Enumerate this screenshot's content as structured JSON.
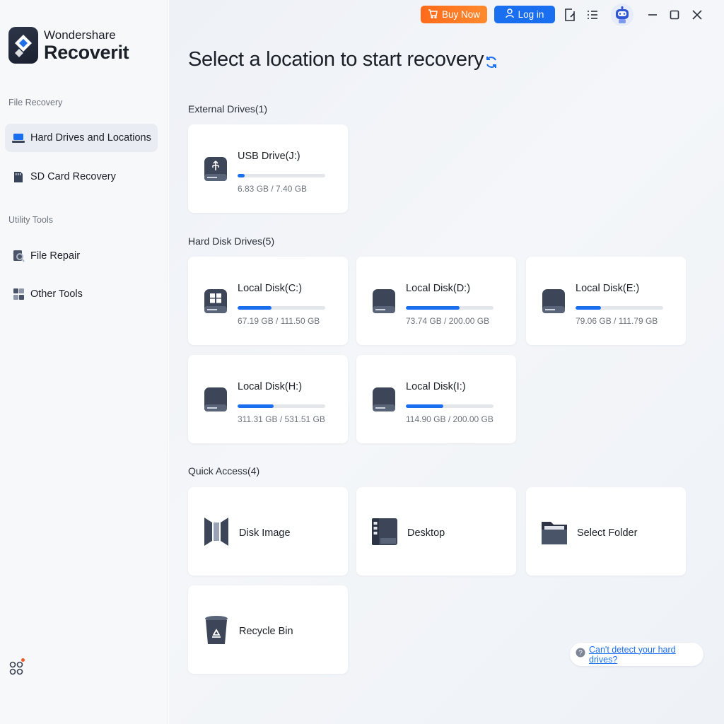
{
  "app": {
    "brand": "Wondershare",
    "product": "Recoverit"
  },
  "sidebar": {
    "sections": [
      {
        "title": "File Recovery",
        "items": [
          {
            "label": "Hard Drives and Locations",
            "active": true
          },
          {
            "label": "SD Card Recovery",
            "active": false
          }
        ]
      },
      {
        "title": "Utility Tools",
        "items": [
          {
            "label": "File Repair",
            "active": false
          },
          {
            "label": "Other Tools",
            "active": false
          }
        ]
      }
    ]
  },
  "titlebar": {
    "buy_label": "Buy Now",
    "login_label": "Log in"
  },
  "main": {
    "title": "Select a location to start recovery",
    "external": {
      "title": "External Drives(1)",
      "drives": [
        {
          "name": "USB Drive(J:)",
          "size": "6.83 GB / 7.40 GB",
          "used": 0.08
        }
      ]
    },
    "hdd": {
      "title": "Hard Disk Drives(5)",
      "drives": [
        {
          "name": "Local Disk(C:)",
          "size": "67.19 GB / 111.50 GB",
          "used": 0.39
        },
        {
          "name": "Local Disk(D:)",
          "size": "73.74 GB / 200.00 GB",
          "used": 0.61
        },
        {
          "name": "Local Disk(E:)",
          "size": "79.06 GB / 111.79 GB",
          "used": 0.29
        },
        {
          "name": "Local Disk(H:)",
          "size": "311.31 GB / 531.51 GB",
          "used": 0.41
        },
        {
          "name": "Local Disk(I:)",
          "size": "114.90 GB / 200.00 GB",
          "used": 0.43
        }
      ]
    },
    "quick": {
      "title": "Quick Access(4)",
      "items": [
        {
          "name": "Disk Image",
          "icon": "disk-image-icon"
        },
        {
          "name": "Desktop",
          "icon": "desktop-icon"
        },
        {
          "name": "Select Folder",
          "icon": "folder-icon"
        },
        {
          "name": "Recycle Bin",
          "icon": "recycle-bin-icon"
        }
      ]
    },
    "help_link": "Can't detect your hard drives?"
  },
  "colors": {
    "accent": "#1a6ef0",
    "buy": "#ff7a22",
    "sidebar_bg": "#f7f8fa",
    "card_bg": "#ffffff"
  }
}
